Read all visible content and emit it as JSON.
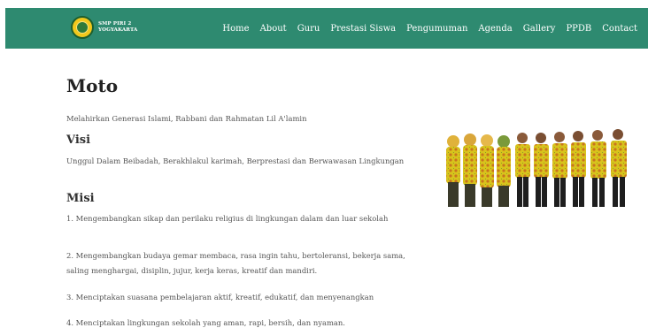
{
  "header": {
    "brand_line1": "SMP PIRI 2",
    "brand_line2": "YOGYAKARTA",
    "nav": [
      "Home",
      "About",
      "Guru",
      "Prestasi Siswa",
      "Pengumuman",
      "Agenda",
      "Gallery",
      "PPDB",
      "Contact"
    ]
  },
  "main": {
    "title": "Moto",
    "motto": "Melahirkan Generasi Islami, Rabbani dan Rahmatan Lil A'lamin",
    "visi_heading": "Visi",
    "visi": "Unggul Dalam Beibadah, Berakhlakul karimah, Berprestasi dan Berwawasan Lingkungan",
    "misi_heading": "Misi",
    "misi": [
      "1. Mengembangkan sikap dan perilaku religius di lingkungan dalam dan luar sekolah",
      "2. Mengembangkan budaya gemar membaca, rasa ingin tahu, bertoleransi, bekerja sama, saling menghargai, disiplin, jujur, kerja keras, kreatif dan mandiri.",
      "3. Menciptakan suasana pembelajaran aktif, kreatif, edukatif, dan menyenangkan",
      "4. Menciptakan lingkungan sekolah yang aman, rapi, bersih, dan nyaman."
    ]
  },
  "colors": {
    "navbar": "#2e8a70",
    "batik_yellow": "#d8c31c",
    "batik_orange": "#c8741e"
  }
}
